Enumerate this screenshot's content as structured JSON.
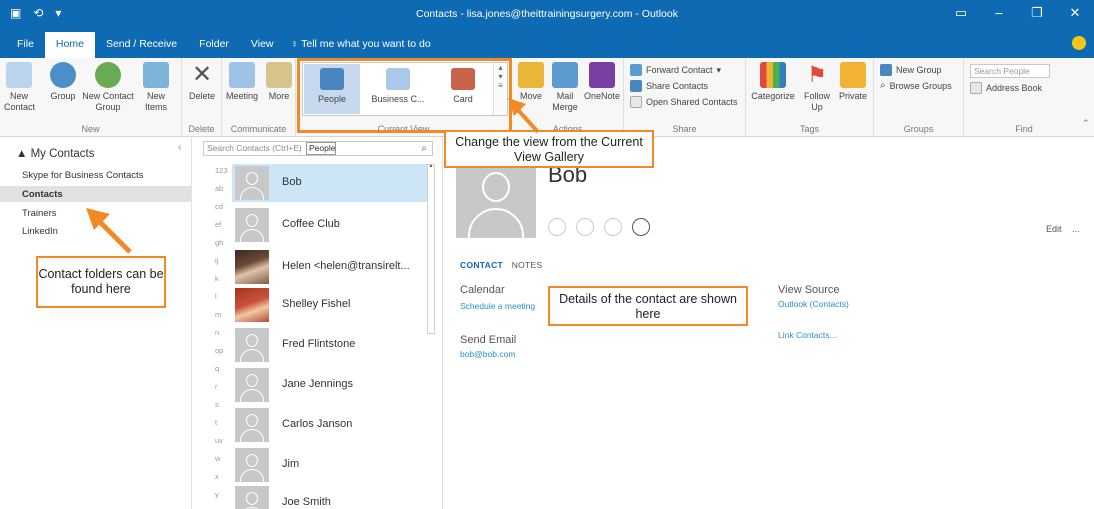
{
  "window": {
    "title": "Contacts - lisa.jones@theittrainingsurgery.com - Outlook"
  },
  "tabs": [
    {
      "label": "File"
    },
    {
      "label": "Home"
    },
    {
      "label": "Send / Receive"
    },
    {
      "label": "Folder"
    },
    {
      "label": "View"
    }
  ],
  "tell_me": "♀ Tell me what you want to do",
  "ribbon": {
    "new": {
      "label": "New",
      "new_contact": "New\nContact",
      "new_group": "Group",
      "new_contact_group": "New Contact\nGroup",
      "new_items": "New\nItems"
    },
    "delete": {
      "label": "Delete",
      "delete_btn": "Delete"
    },
    "communicate": {
      "label": "Communicate",
      "meeting": "Meeting",
      "more": "More"
    },
    "current_view": {
      "label": "Current View",
      "people": "People",
      "business_card": "Business C...",
      "card": "Card"
    },
    "actions": {
      "label": "Actions",
      "move": "Move",
      "mail_merge": "Mail\nMerge",
      "onenote": "OneNote"
    },
    "share": {
      "label": "Share",
      "forward_contact": "Forward Contact",
      "share_contacts": "Share Contacts",
      "open_shared": "Open Shared Contacts"
    },
    "tags": {
      "label": "Tags",
      "categorize": "Categorize",
      "follow_up": "Follow\nUp",
      "private": "Private"
    },
    "groups": {
      "label": "Groups",
      "new_group": "New Group",
      "browse_groups": "Browse Groups"
    },
    "find": {
      "label": "Find",
      "search_people": "Search People",
      "address_book": "Address Book"
    }
  },
  "nav": {
    "header": "▲ My Contacts",
    "items": [
      {
        "label": "Skype for Business Contacts"
      },
      {
        "label": "Contacts"
      },
      {
        "label": "Trainers"
      },
      {
        "label": "LinkedIn"
      }
    ]
  },
  "list": {
    "search_placeholder": "Search Contacts (Ctrl+E)",
    "tooltip": "People",
    "alpha_index": [
      "123",
      "ab",
      "cd",
      "ef",
      "gh",
      "ij",
      "k",
      "l",
      "m",
      "n",
      "op",
      "q",
      "r",
      "s",
      "t",
      "uv",
      "w",
      "x",
      "y"
    ],
    "contacts": [
      {
        "name": "Bob"
      },
      {
        "name": "Coffee Club"
      },
      {
        "name": "Helen <helen@transirelt..."
      },
      {
        "name": "Shelley Fishel"
      },
      {
        "name": "Fred Flintstone"
      },
      {
        "name": "Jane Jennings"
      },
      {
        "name": "Carlos Janson"
      },
      {
        "name": "Jim"
      },
      {
        "name": "Joe Smith"
      }
    ]
  },
  "reading": {
    "name": "Bob",
    "edit": "Edit",
    "more": "...",
    "tab_contact": "CONTACT",
    "tab_notes": "NOTES",
    "calendar_label": "Calendar",
    "schedule_link": "Schedule a meeting",
    "send_email_label": "Send Email",
    "email": "bob@bob.com",
    "view_source_label": "View Source",
    "source_link": "Outlook (Contacts)",
    "link_contacts": "Link Contacts..."
  },
  "annotations": {
    "view_gallery": "Change the view from the Current View Gallery",
    "contact_folders": "Contact folders can be found here",
    "details": "Details of the contact are shown here"
  },
  "colors": {
    "accent": "#0f6ab4",
    "callout": "#f08a24",
    "selected_row": "#cde6f7"
  }
}
